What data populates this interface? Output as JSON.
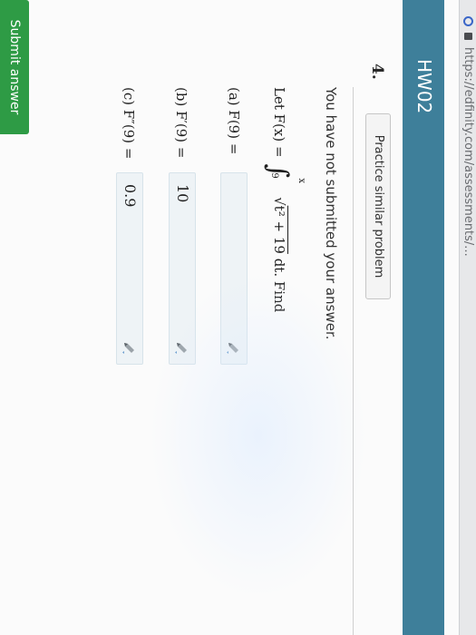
{
  "browser": {
    "url": "https://edfinity.com/assessments/..."
  },
  "header": {
    "title": "HW02"
  },
  "question": {
    "number": "4.",
    "practice_label": "Practice similar problem",
    "status": "You have not submitted your answer.",
    "prompt_prefix": "Let F(x) =",
    "upper_limit": "x",
    "lower_limit": "9",
    "integrand": "t² + 19",
    "differential": "dt.",
    "prompt_suffix": "Find"
  },
  "parts": [
    {
      "label": "(a) F(9) =",
      "value": ""
    },
    {
      "label": "(b) F′(9) =",
      "value": "10"
    },
    {
      "label": "(c) F″(9) =",
      "value": "0.9"
    }
  ],
  "submit": {
    "label": "Submit answer"
  },
  "colors": {
    "header": "#3e7f9a",
    "submit": "#2e9b45",
    "answer_bg": "#eef3f6"
  }
}
